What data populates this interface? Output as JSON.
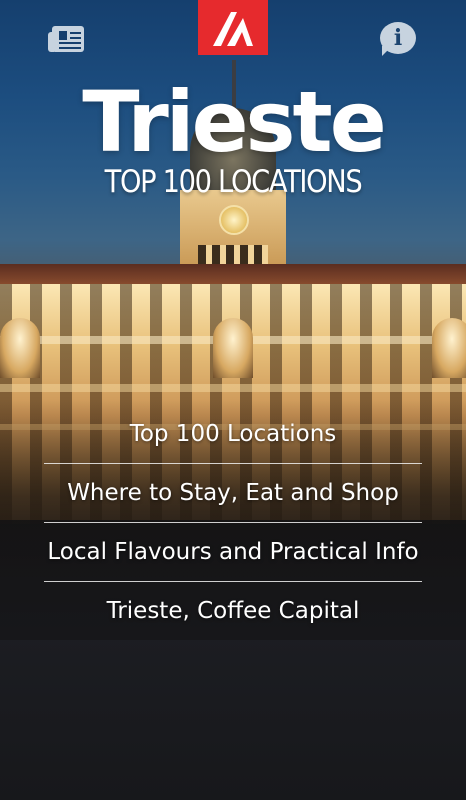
{
  "app": {
    "title": "Trieste",
    "subtitle": "TOP 100 LOCATIONS"
  },
  "header": {
    "left_icon": "newspaper-icon",
    "logo": "touring-logo",
    "right_icon": "info-icon",
    "info_glyph": "i"
  },
  "colors": {
    "logo_red": "#e62a2d",
    "icon_fill": "#c7d3df",
    "text": "#ffffff"
  },
  "menu": {
    "items": [
      {
        "label": "Top 100 Locations"
      },
      {
        "label": "Where to Stay, Eat and Shop"
      },
      {
        "label": "Local Flavours and Practical Info"
      },
      {
        "label": "Trieste, Coffee Capital"
      }
    ]
  }
}
